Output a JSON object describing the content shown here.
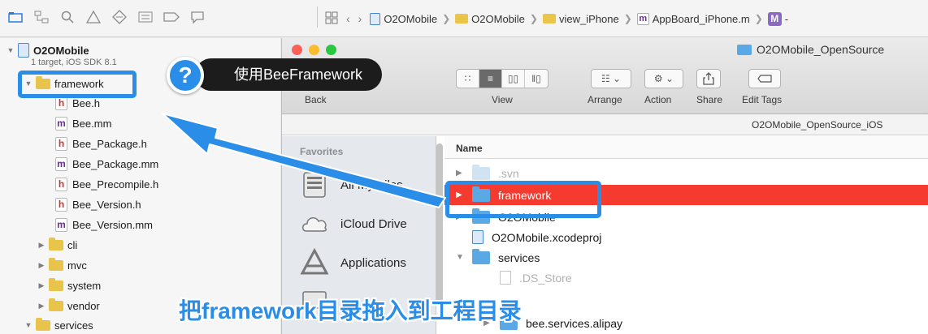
{
  "xcode": {
    "navigator_icons": [
      "folder-icon",
      "hierarchy-icon",
      "search-icon",
      "warning-icon",
      "test-icon",
      "debug-icon",
      "breakpoint-icon",
      "log-icon"
    ],
    "jumpbar": {
      "items": [
        "O2OMobile",
        "O2OMobile",
        "view_iPhone",
        "AppBoard_iPhone.m",
        "-"
      ]
    },
    "project": {
      "name": "O2OMobile",
      "subtitle": "1 target, iOS SDK 8.1"
    },
    "tree": [
      {
        "label": "framework",
        "kind": "folder",
        "open": true
      },
      {
        "label": "Bee.h",
        "kind": "h"
      },
      {
        "label": "Bee.mm",
        "kind": "m"
      },
      {
        "label": "Bee_Package.h",
        "kind": "h"
      },
      {
        "label": "Bee_Package.mm",
        "kind": "m"
      },
      {
        "label": "Bee_Precompile.h",
        "kind": "h"
      },
      {
        "label": "Bee_Version.h",
        "kind": "h"
      },
      {
        "label": "Bee_Version.mm",
        "kind": "m"
      },
      {
        "label": "cli",
        "kind": "folder"
      },
      {
        "label": "mvc",
        "kind": "folder"
      },
      {
        "label": "system",
        "kind": "folder"
      },
      {
        "label": "vendor",
        "kind": "folder"
      },
      {
        "label": "services",
        "kind": "folder",
        "open": true
      }
    ]
  },
  "finder": {
    "title": "O2OMobile_OpenSource",
    "toolbar": {
      "back": "Back",
      "view": "View",
      "arrange": "Arrange",
      "action": "Action",
      "share": "Share",
      "edit_tags": "Edit Tags"
    },
    "path": "O2OMobile_OpenSource_iOS",
    "sidebar": {
      "heading": "Favorites",
      "items": [
        "All My Files",
        "iCloud Drive",
        "Applications"
      ]
    },
    "column_name": "Name",
    "rows": [
      {
        "label": ".svn",
        "kind": "folder",
        "faded": true
      },
      {
        "label": "framework",
        "kind": "folder",
        "selected": true
      },
      {
        "label": "O2OMobile",
        "kind": "folder"
      },
      {
        "label": "O2OMobile.xcodeproj",
        "kind": "xcodeproj"
      },
      {
        "label": "services",
        "kind": "folder",
        "open": true
      },
      {
        "label": ".DS_Store",
        "kind": "file",
        "faded": true
      },
      {
        "label": "bee.services.alipay",
        "kind": "folder"
      }
    ]
  },
  "overlay": {
    "bubble": "使用BeeFramework",
    "question": "?",
    "caption": "把framework目录拖入到工程目录",
    "accent": "#2a8de8"
  }
}
